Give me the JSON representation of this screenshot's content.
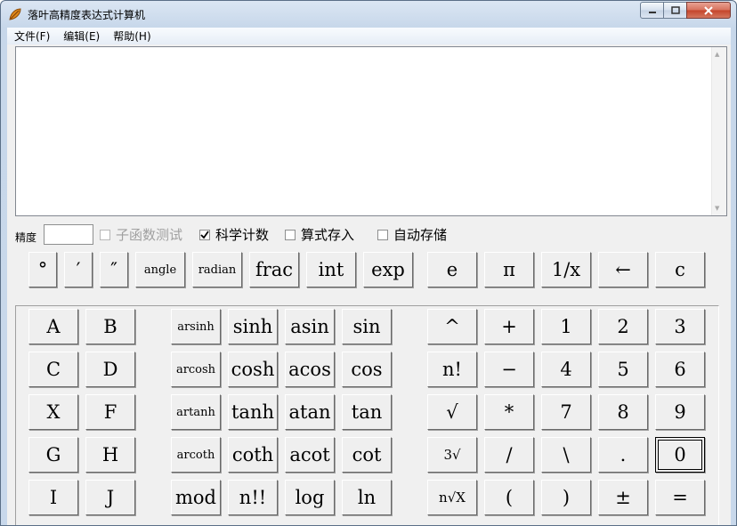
{
  "window": {
    "title": "落叶高精度表达式计算机"
  },
  "menu": [
    "文件(F)",
    "编辑(E)",
    "帮助(H)"
  ],
  "display": {
    "value": ""
  },
  "options": {
    "precision_label": "精度",
    "precision_value": "",
    "checkboxes": [
      {
        "label": "子函数测试",
        "checked": false,
        "enabled": false
      },
      {
        "label": "科学计数",
        "checked": true,
        "enabled": true
      },
      {
        "label": "算式存入",
        "checked": false,
        "enabled": true
      },
      {
        "label": "自动存储",
        "checked": false,
        "enabled": true
      }
    ]
  },
  "top_row": [
    "°",
    "′",
    "″",
    "angle",
    "radian",
    "frac",
    "int",
    "exp",
    "e",
    "π",
    "1/x",
    "←",
    "c"
  ],
  "keypad": {
    "letters": [
      [
        "A",
        "B"
      ],
      [
        "C",
        "D"
      ],
      [
        "X",
        "F"
      ],
      [
        "G",
        "H"
      ],
      [
        "I",
        "J"
      ]
    ],
    "functions": [
      [
        "arsinh",
        "sinh",
        "asin",
        "sin"
      ],
      [
        "arcosh",
        "cosh",
        "acos",
        "cos"
      ],
      [
        "artanh",
        "tanh",
        "atan",
        "tan"
      ],
      [
        "arcoth",
        "coth",
        "acot",
        "cot"
      ],
      [
        "mod",
        "n!!",
        "log",
        "ln"
      ]
    ],
    "operators": [
      [
        "^",
        "+"
      ],
      [
        "n!",
        "−"
      ],
      [
        "√",
        "*"
      ],
      [
        "3√",
        "/"
      ],
      [
        "n√X",
        "("
      ]
    ],
    "digits": [
      [
        "1",
        "2",
        "3"
      ],
      [
        "4",
        "5",
        "6"
      ],
      [
        "7",
        "8",
        "9"
      ],
      [
        "\\",
        ".",
        "0"
      ],
      [
        ")",
        "±",
        "="
      ]
    ]
  },
  "colors": {
    "titlebar": "#c8d8eb",
    "close_button": "#c4442a",
    "client_bg": "#f0f0f0"
  }
}
